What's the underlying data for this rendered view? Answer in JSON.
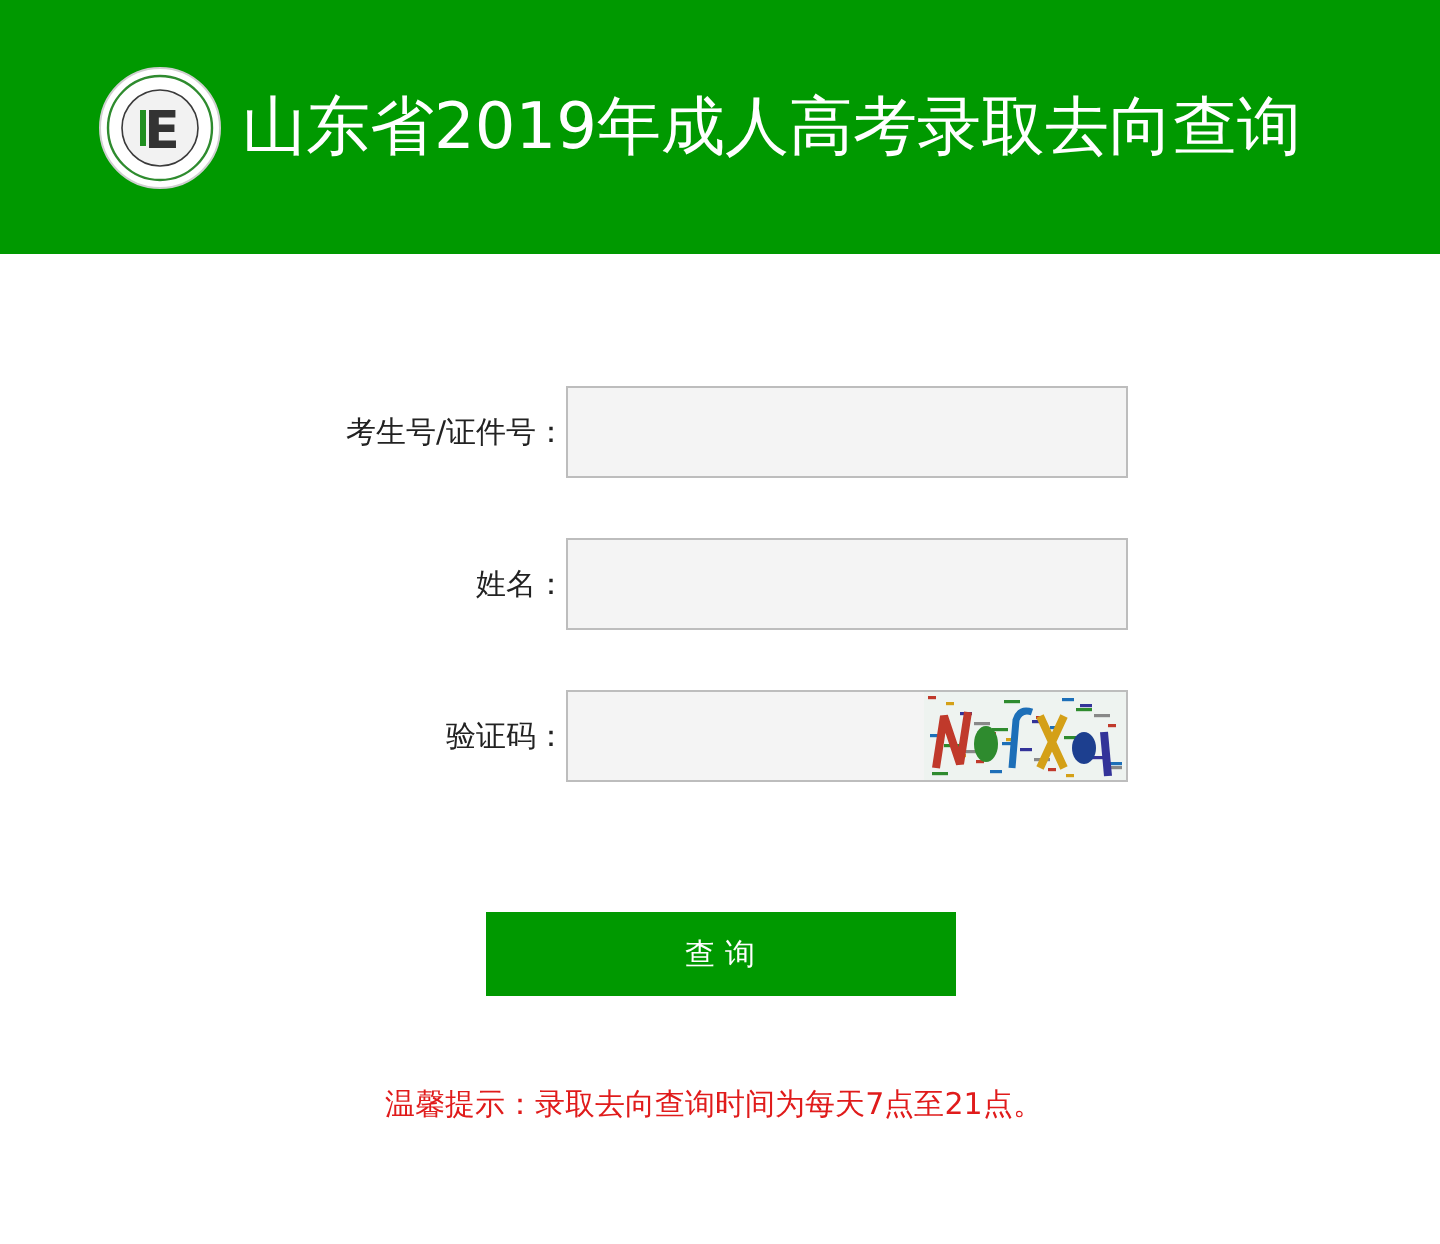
{
  "header": {
    "logo": {
      "letter": "E"
    },
    "title": "山东省2019年成人高考录取去向查询"
  },
  "form": {
    "fields": [
      {
        "kind": "text",
        "label": "考生号/证件号："
      },
      {
        "kind": "text",
        "label": "姓名："
      },
      {
        "kind": "captcha",
        "label": "验证码："
      }
    ],
    "submit": {
      "label": "查 询"
    }
  },
  "notice": "温馨提示：录取去向查询时间为每天7点至21点。"
}
